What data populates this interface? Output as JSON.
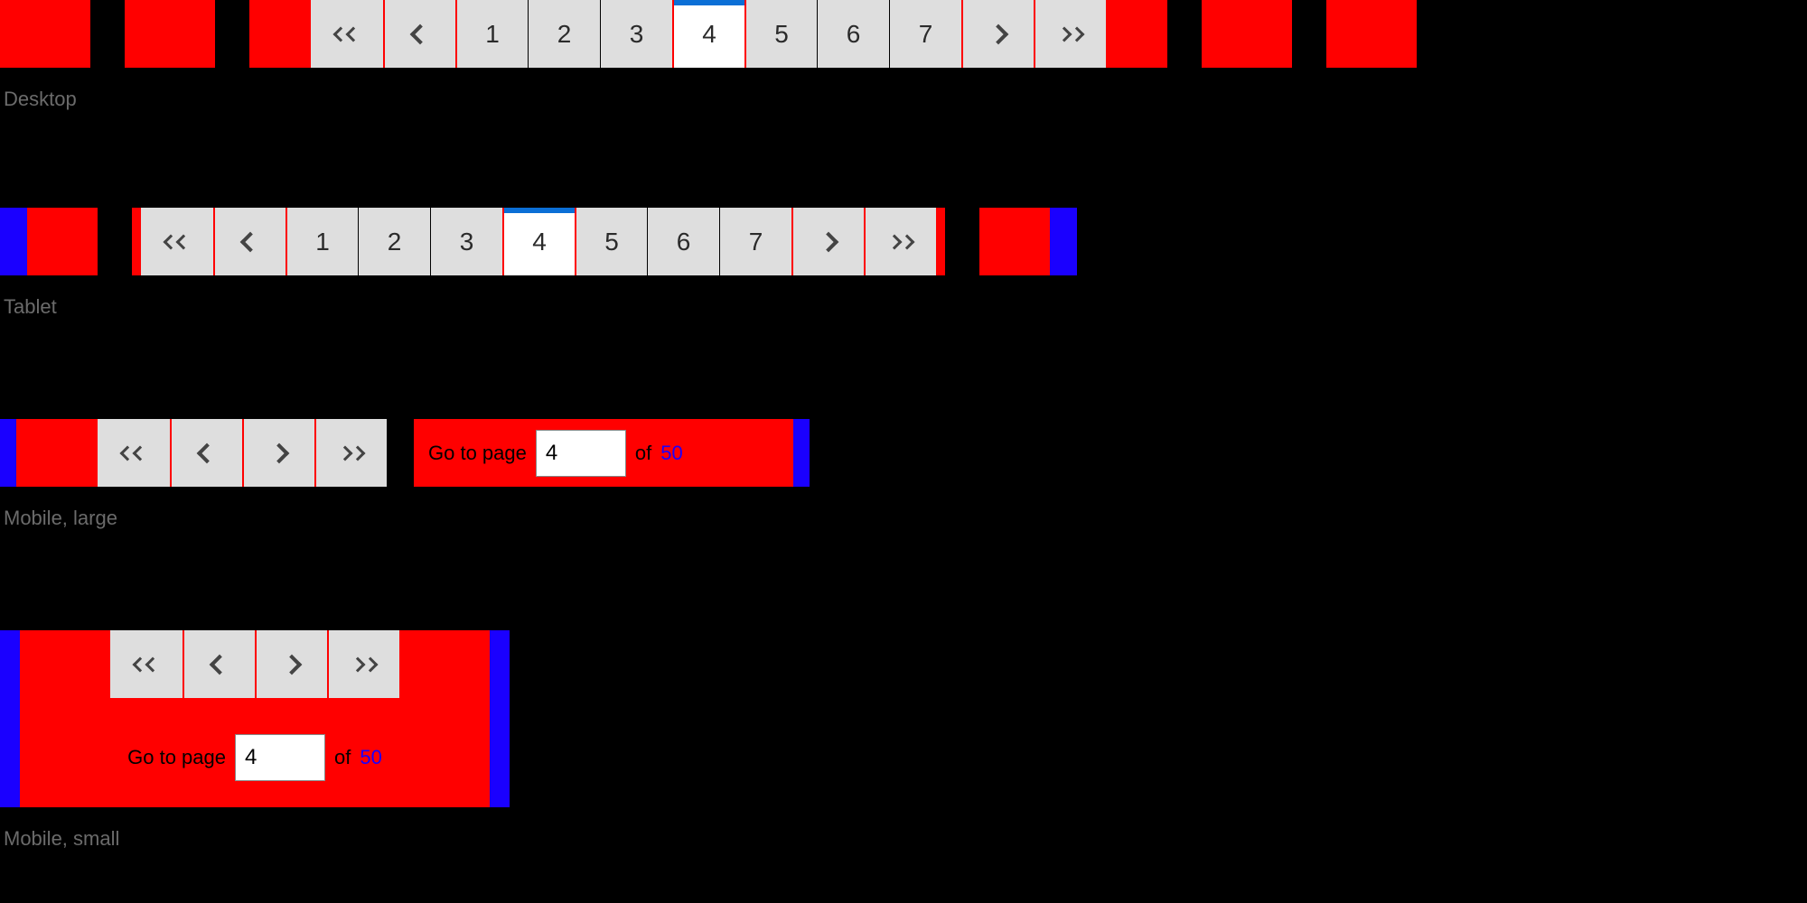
{
  "labels": {
    "desktop": "Desktop",
    "tablet": "Tablet",
    "mobile_large": "Mobile, large",
    "mobile_small": "Mobile, small"
  },
  "pager": {
    "pages": [
      "1",
      "2",
      "3",
      "4",
      "5",
      "6",
      "7"
    ],
    "active": "4"
  },
  "goto": {
    "prefix": "Go to page",
    "value": "4",
    "of": "of",
    "total": "50"
  }
}
